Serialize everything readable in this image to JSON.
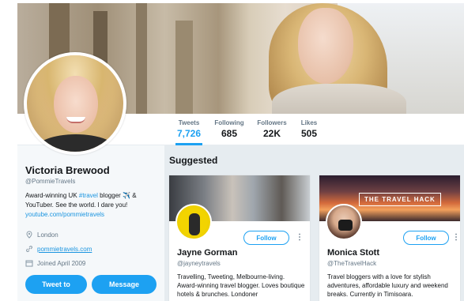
{
  "profile": {
    "name": "Victoria Brewood",
    "handle": "@PommieTravels",
    "bio_part1": "Award-winning UK ",
    "bio_hashtag": "#travel",
    "bio_part2": " blogger ✈️ & YouTuber. See the world. I dare you!",
    "bio_link": "youtube.com/pommietravels",
    "location": "London",
    "website": "pommietravels.com",
    "joined": "Joined April 2009"
  },
  "stats": [
    {
      "label": "Tweets",
      "value": "7,726"
    },
    {
      "label": "Following",
      "value": "685"
    },
    {
      "label": "Followers",
      "value": "22K"
    },
    {
      "label": "Likes",
      "value": "505"
    }
  ],
  "buttons": {
    "tweet_to": "Tweet to",
    "message": "Message"
  },
  "suggested": {
    "title": "Suggested",
    "cards": [
      {
        "name": "Jayne Gorman",
        "handle": "@jayneytravels",
        "follow": "Follow",
        "more": "⋮",
        "bio": "Travelling, Tweeting, Melbourne-living. Award-winning travel blogger. Loves boutique hotels & brunches. Londoner"
      },
      {
        "name": "Monica Stott",
        "handle": "@TheTravelHack",
        "follow": "Follow",
        "more": "⋮",
        "cover_text": "THE TRAVEL HACK",
        "bio": "Travel bloggers with a love for stylish adventures, affordable luxury and weekend breaks. Currently in Timisoara."
      }
    ]
  },
  "colors": {
    "accent": "#1da1f2",
    "link": "#1b95e0",
    "muted": "#657786"
  },
  "icons": {
    "location": "location-pin-icon",
    "website": "link-icon",
    "joined": "calendar-icon"
  }
}
